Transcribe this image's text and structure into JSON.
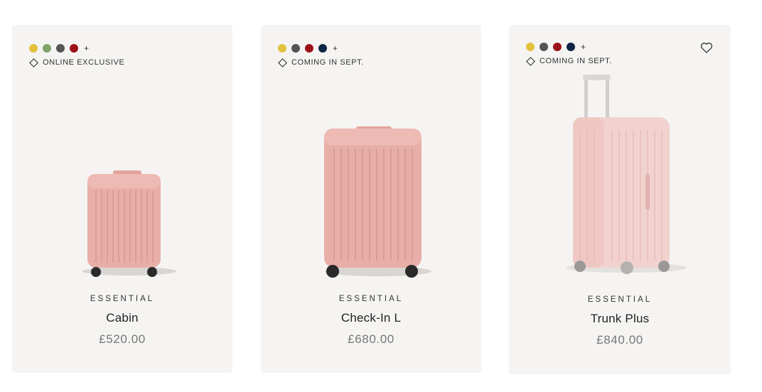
{
  "products": [
    {
      "swatches": [
        "#e2c23d",
        "#7fa36b",
        "#555555",
        "#b0141e"
      ],
      "swatch_striped": [
        false,
        false,
        false,
        true
      ],
      "more_label": "+",
      "badge": "ONLINE EXCLUSIVE",
      "category": "ESSENTIAL",
      "name": "Cabin",
      "price": "£520.00",
      "icon": "cabin-suitcase-image"
    },
    {
      "swatches": [
        "#e2c23d",
        "#555555",
        "#b0141e",
        "#132a4f"
      ],
      "swatch_striped": [
        false,
        false,
        true,
        true
      ],
      "more_label": "+",
      "badge": "COMING IN SEPT.",
      "category": "ESSENTIAL",
      "name": "Check-In L",
      "price": "£680.00",
      "icon": "check-in-suitcase-image"
    },
    {
      "swatches": [
        "#e2c23d",
        "#555555",
        "#b0141e",
        "#132a4f"
      ],
      "swatch_striped": [
        false,
        false,
        true,
        true
      ],
      "more_label": "+",
      "badge": "COMING IN SEPT.",
      "category": "ESSENTIAL",
      "name": "Trunk Plus",
      "price": "£840.00",
      "icon": "trunk-suitcase-image",
      "wishlist_icon": "heart-icon"
    }
  ],
  "colors": {
    "card_bg": "#f5f4f2",
    "suitcase_pink": "#e8aea8",
    "suitcase_pink_light": "#f2d2ce"
  }
}
